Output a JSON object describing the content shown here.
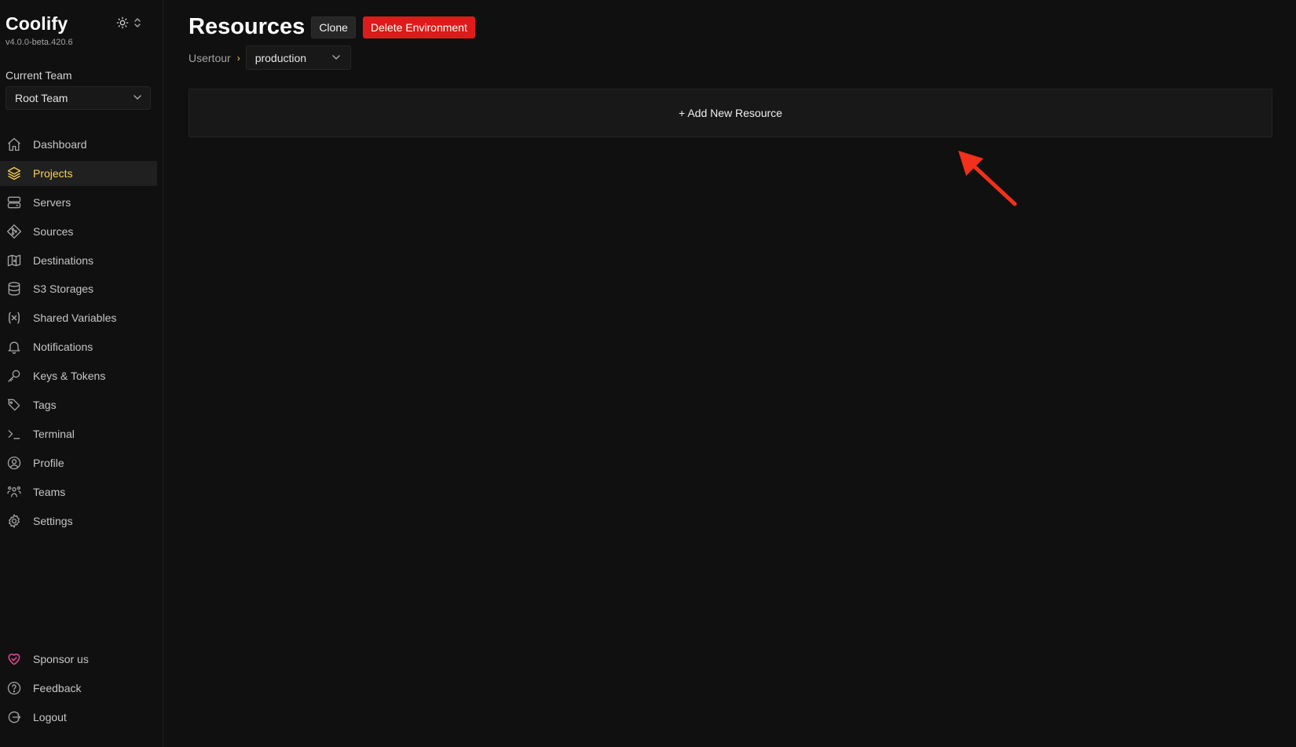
{
  "brand": {
    "title": "Coolify",
    "version": "v4.0.0-beta.420.6"
  },
  "team": {
    "label": "Current Team",
    "selected": "Root Team"
  },
  "nav": {
    "items": [
      {
        "label": "Dashboard",
        "icon": "home-icon"
      },
      {
        "label": "Projects",
        "icon": "layers-icon",
        "active": true
      },
      {
        "label": "Servers",
        "icon": "server-icon"
      },
      {
        "label": "Sources",
        "icon": "git-icon"
      },
      {
        "label": "Destinations",
        "icon": "map-icon"
      },
      {
        "label": "S3 Storages",
        "icon": "database-icon"
      },
      {
        "label": "Shared Variables",
        "icon": "variable-icon"
      },
      {
        "label": "Notifications",
        "icon": "bell-icon"
      },
      {
        "label": "Keys & Tokens",
        "icon": "key-icon"
      },
      {
        "label": "Tags",
        "icon": "tag-icon"
      },
      {
        "label": "Terminal",
        "icon": "terminal-icon"
      },
      {
        "label": "Profile",
        "icon": "user-circle-icon"
      },
      {
        "label": "Teams",
        "icon": "users-icon"
      },
      {
        "label": "Settings",
        "icon": "gear-icon"
      }
    ],
    "bottom": [
      {
        "label": "Sponsor us",
        "icon": "heart-icon"
      },
      {
        "label": "Feedback",
        "icon": "help-circle-icon"
      },
      {
        "label": "Logout",
        "icon": "logout-icon"
      }
    ]
  },
  "header": {
    "title": "Resources",
    "clone_label": "Clone",
    "delete_label": "Delete Environment"
  },
  "breadcrumb": {
    "project": "Usertour",
    "separator": "›",
    "environment": "production"
  },
  "main": {
    "add_resource_label": "+ Add New Resource"
  },
  "colors": {
    "accent": "#fcd452",
    "danger": "#dc1b1b",
    "sponsor": "#ec4899",
    "annotation_arrow": "#f2301b"
  }
}
